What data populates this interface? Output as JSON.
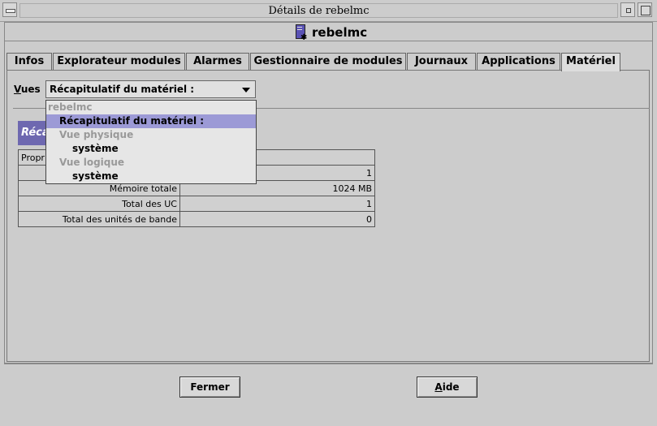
{
  "window": {
    "title": "Détails de rebelmc",
    "host_name": "rebelmc"
  },
  "tabs": [
    {
      "label": "Infos"
    },
    {
      "label": "Explorateur modules"
    },
    {
      "label": "Alarmes"
    },
    {
      "label": "Gestionnaire de modules"
    },
    {
      "label": "Journaux"
    },
    {
      "label": "Applications"
    },
    {
      "label": "Matériel",
      "active": true
    }
  ],
  "views": {
    "label_first": "V",
    "label_rest": "ues",
    "selected": "Récapitulatif du matériel :"
  },
  "dropdown": {
    "items": [
      {
        "label": "rebelmc",
        "kind": "group"
      },
      {
        "label": "Récapitulatif du matériel :",
        "kind": "leaf",
        "selected": true
      },
      {
        "label": "Vue physique",
        "kind": "group"
      },
      {
        "label": "système",
        "kind": "leaf"
      },
      {
        "label": "Vue logique",
        "kind": "group"
      },
      {
        "label": "système",
        "kind": "leaf"
      }
    ]
  },
  "summary": {
    "header_visible": "Réca",
    "table_header_visible": "Propri",
    "rows": [
      {
        "label": "",
        "value": "1"
      },
      {
        "label": "Mémoire totale",
        "value": "1024 MB"
      },
      {
        "label": "Total des UC",
        "value": "1"
      },
      {
        "label": "Total des unités de bande",
        "value": "0"
      }
    ]
  },
  "buttons": {
    "close": "Fermer",
    "help_first": "A",
    "help_rest": "ide"
  },
  "colors": {
    "background": "#cccccc",
    "selection": "#9c9ad6",
    "summary_header": "#6e68b0"
  }
}
